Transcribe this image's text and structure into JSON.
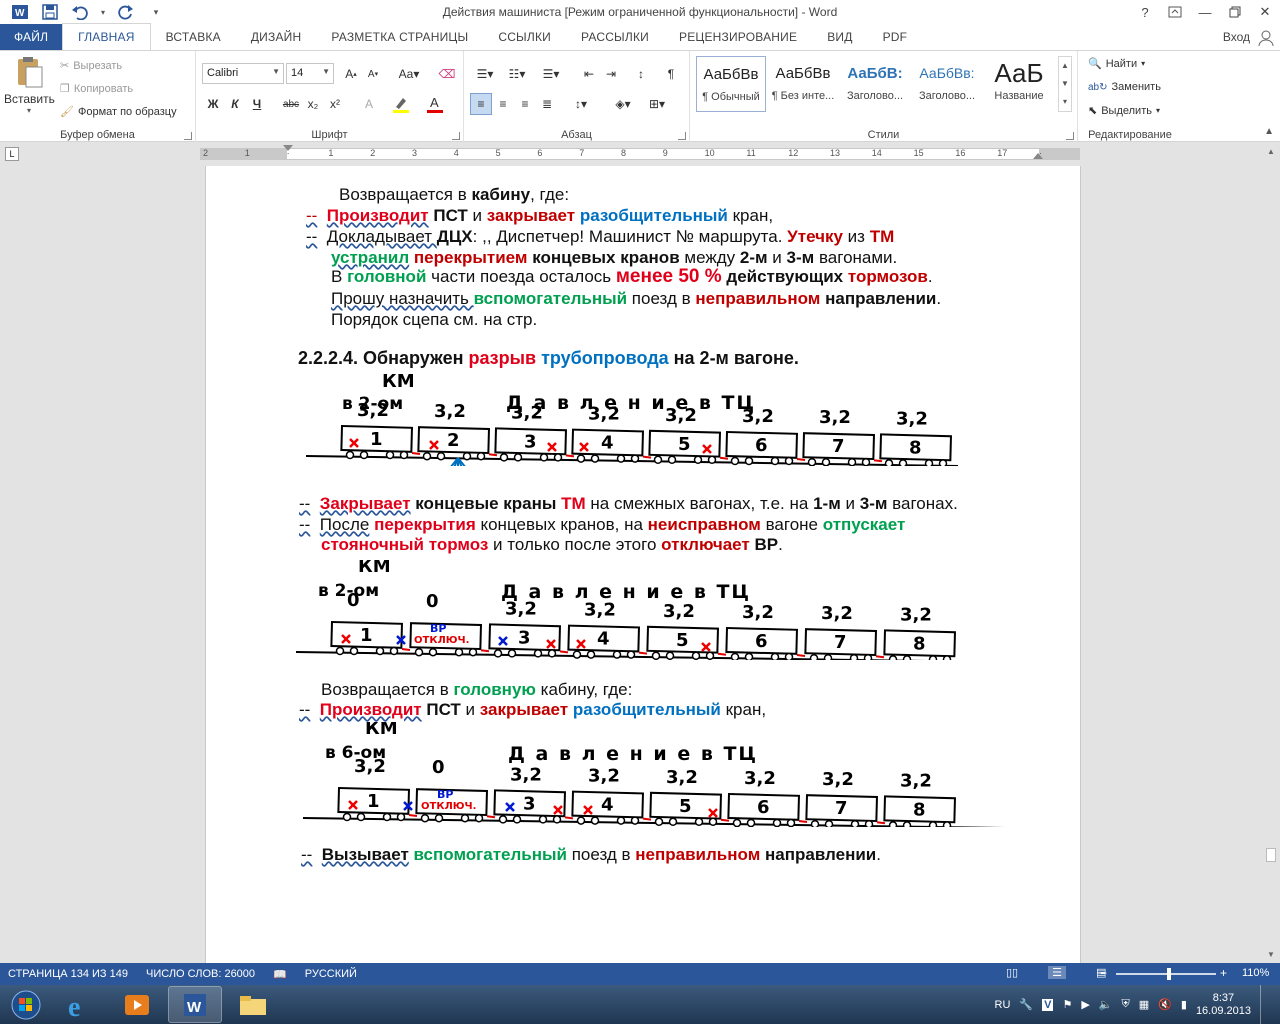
{
  "window": {
    "title": "Действия   машиниста [Режим ограниченной функциональности] - Word",
    "help": "?",
    "signin": "Вход"
  },
  "tabs": [
    "ФАЙЛ",
    "ГЛАВНАЯ",
    "ВСТАВКА",
    "ДИЗАЙН",
    "РАЗМЕТКА СТРАНИЦЫ",
    "ССЫЛКИ",
    "РАССЫЛКИ",
    "РЕЦЕНЗИРОВАНИЕ",
    "ВИД",
    "PDF"
  ],
  "clipboard": {
    "paste": "Вставить",
    "cut": "Вырезать",
    "copy": "Копировать",
    "format_painter": "Формат по образцу",
    "label": "Буфер обмена"
  },
  "font": {
    "name": "Calibri",
    "size": "14",
    "label": "Шрифт",
    "bold": "Ж",
    "italic": "К",
    "underline": "Ч",
    "strike": "abc",
    "sub": "x₂",
    "sup": "x²"
  },
  "paragraph": {
    "label": "Абзац"
  },
  "styles": {
    "label": "Стили",
    "items": [
      {
        "preview": "АаБбВв",
        "name": "¶ Обычный"
      },
      {
        "preview": "АаБбВв",
        "name": "¶ Без инте..."
      },
      {
        "preview": "АаБбВ:",
        "name": "Заголово..."
      },
      {
        "preview": "АаБбВв:",
        "name": "Заголово..."
      },
      {
        "preview": "АаБ",
        "name": "Название"
      }
    ]
  },
  "editing": {
    "find": "Найти",
    "replace": "Заменить",
    "select": "Выделить",
    "label": "Редактирование"
  },
  "ruler": {
    "marks": [
      "2",
      "1",
      "",
      "1",
      "2",
      "3",
      "4",
      "5",
      "6",
      "7",
      "8",
      "9",
      "10",
      "11",
      "12",
      "13",
      "14",
      "15",
      "16",
      "17",
      ""
    ]
  },
  "doc": {
    "l1": {
      "a": "Возвращается в ",
      "b": "кабину",
      "c": ", где:"
    },
    "l2": {
      "dash": "--",
      "a": "Производит",
      "b": "ПСТ",
      "c": " и ",
      "d": "закрывает",
      "e": "разобщительный",
      "f": " кран,"
    },
    "l3": {
      "dash": "--",
      "a": "Докладывает ",
      "b": "ДЦХ",
      "c": ": ,, Диспетчер! Машинист № маршрута. ",
      "d": "Утечку",
      "e": " из ",
      "f": "ТМ"
    },
    "l4": {
      "a": "устранил",
      "b": "перекрытием",
      "c": "концевых кранов",
      "d": "  между ",
      "e": "2-м",
      "f": " и ",
      "g": "3-м",
      "h": " вагонами."
    },
    "l5": {
      "a": "В ",
      "b": "головной",
      "c": " части поезда осталось ",
      "d": "менее 50 %",
      "e": " действующих ",
      "f": "тормозов",
      "g": "."
    },
    "l6": {
      "a": "Прошу  назначить ",
      "b": "вспомогательный",
      "c": " поезд в ",
      "d": "неправильном",
      "e": " направлении",
      "f": "."
    },
    "l7": "Порядок сцепа см. на стр.",
    "h": {
      "num": "2.2.2.4.",
      "a": "  Обнаружен ",
      "b": "разрыв",
      "c": "трубопровода",
      "d": " на 2-м вагоне."
    },
    "p1": {
      "dash": "--",
      "a": "Закрывает",
      "b": " концевые краны ",
      "c": "ТМ",
      "d": " на смежных вагонах, т.е. на ",
      "e": "1-м",
      "f": " и ",
      "g": "3-м",
      "h": " вагонах."
    },
    "p2": {
      "dash": "--",
      "a": "После",
      "b": "перекрытия",
      "c": " концевых кранов, на ",
      "d": "неисправном",
      "e": " вагоне ",
      "f": "отпускает"
    },
    "p3": {
      "a": "стояночный",
      "b": "тормоз",
      "c": " и только после этого ",
      "d": "отключает",
      "e": " ВР",
      "f": "."
    },
    "p4": {
      "a": "Возвращается в ",
      "b": "головную",
      "c": " кабину, где:"
    },
    "p5": {
      "dash": "--",
      "a": "Производит",
      "b": "ПСТ",
      "c": " и ",
      "d": "закрывает",
      "e": "разобщительный",
      "f": " кран,"
    },
    "p6": {
      "dash": "--",
      "a": "Вызывает",
      "b": "вспомогательный",
      "c": " поезд в ",
      "d": "неправильном",
      "e": " направлении",
      "f": "."
    }
  },
  "diagrams": [
    {
      "km1": "КМ",
      "km2": "в 2-ом",
      "title": "Д а в л е н и е   в   ТЦ",
      "pressures": [
        "3,2",
        "3,2",
        "3,2",
        "3,2",
        "3,2",
        "3,2",
        "3,2",
        "3,2"
      ],
      "cars": [
        "1",
        "2",
        "3",
        "4",
        "5",
        "6",
        "7",
        "8"
      ],
      "vr": ""
    },
    {
      "km1": "КМ",
      "km2": "в 2-ом",
      "title": "Д а в л е н и е   в   ТЦ",
      "pressures": [
        "0",
        "0",
        "3,2",
        "3,2",
        "3,2",
        "3,2",
        "3,2",
        "3,2"
      ],
      "cars": [
        "1",
        "",
        "3",
        "4",
        "5",
        "6",
        "7",
        "8"
      ],
      "vr": "ВР",
      "vr2": "ОТКЛЮЧ."
    },
    {
      "km1": "КМ",
      "km2": "в 6-ом",
      "title": "Д а в л е н и е   в   ТЦ",
      "pressures": [
        "3,2",
        "0",
        "3,2",
        "3,2",
        "3,2",
        "3,2",
        "3,2",
        "3,2"
      ],
      "cars": [
        "1",
        "",
        "3",
        "4",
        "5",
        "6",
        "7",
        "8"
      ],
      "vr": "ВР",
      "vr2": "ОТКЛЮЧ."
    }
  ],
  "status": {
    "page": "СТРАНИЦА 134 ИЗ 149",
    "words": "ЧИСЛО СЛОВ: 26000",
    "lang": "РУССКИЙ",
    "zoom": "110%"
  },
  "tray": {
    "lang": "RU",
    "time": "8:37",
    "date": "16.09.2013"
  }
}
